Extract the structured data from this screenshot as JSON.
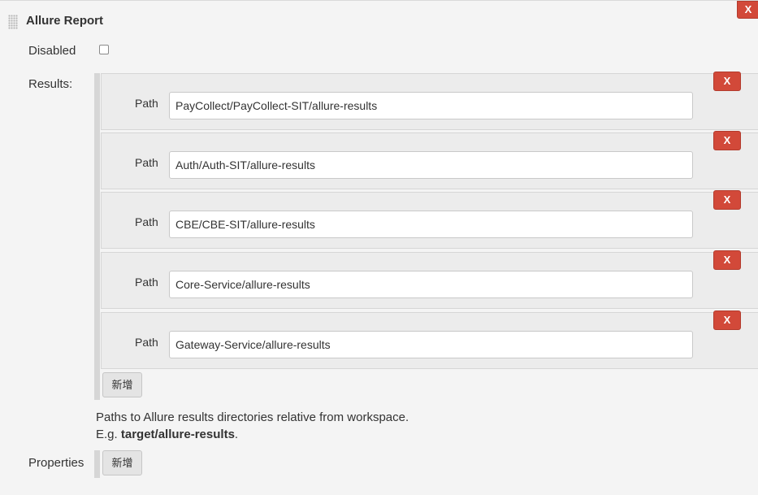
{
  "section": {
    "title": "Allure Report",
    "close_label": "X"
  },
  "disabled": {
    "label": "Disabled",
    "checked": false
  },
  "results": {
    "label": "Results:",
    "path_label": "Path",
    "remove_label": "X",
    "items": [
      {
        "path": "PayCollect/PayCollect-SIT/allure-results"
      },
      {
        "path": "Auth/Auth-SIT/allure-results"
      },
      {
        "path": "CBE/CBE-SIT/allure-results"
      },
      {
        "path": "Core-Service/allure-results"
      },
      {
        "path": "Gateway-Service/allure-results"
      }
    ],
    "add_label": "新增",
    "help_line1": "Paths to Allure results directories relative from workspace.",
    "help_prefix": "E.g. ",
    "help_example": "target/allure-results",
    "help_suffix": "."
  },
  "properties": {
    "label": "Properties",
    "add_label": "新增"
  },
  "colors": {
    "remove_button": "#d24939",
    "background": "#f4f4f4"
  }
}
